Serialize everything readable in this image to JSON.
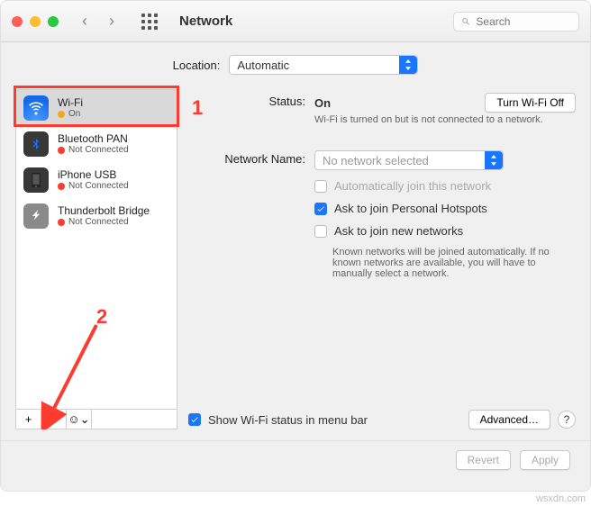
{
  "header": {
    "title": "Network",
    "search_placeholder": "Search"
  },
  "location": {
    "label": "Location:",
    "value": "Automatic"
  },
  "sidebar": {
    "items": [
      {
        "name": "Wi-Fi",
        "status": "On",
        "dot": "on",
        "icon": "wifi",
        "selected": true
      },
      {
        "name": "Bluetooth PAN",
        "status": "Not Connected",
        "dot": "off",
        "icon": "bt",
        "selected": false
      },
      {
        "name": "iPhone USB",
        "status": "Not Connected",
        "dot": "off",
        "icon": "usb",
        "selected": false
      },
      {
        "name": "Thunderbolt Bridge",
        "status": "Not Connected",
        "dot": "off",
        "icon": "tb",
        "selected": false
      }
    ],
    "actions": {
      "add": "+",
      "remove": "−",
      "more": "☺︎⌄"
    }
  },
  "detail": {
    "status_label": "Status:",
    "status_value": "On",
    "turn_off": "Turn Wi-Fi Off",
    "status_sub": "Wi-Fi is turned on but is not connected to a network.",
    "network_label": "Network Name:",
    "network_placeholder": "No network selected",
    "auto_join": "Automatically join this network",
    "ask_hotspot": "Ask to join Personal Hotspots",
    "ask_new": "Ask to join new networks",
    "ask_new_sub": "Known networks will be joined automatically. If no known networks are available, you will have to manually select a network.",
    "show_menubar": "Show Wi-Fi status in menu bar",
    "advanced": "Advanced…",
    "help": "?"
  },
  "footer": {
    "revert": "Revert",
    "apply": "Apply"
  },
  "annotations": {
    "one": "1",
    "two": "2"
  },
  "watermark": "wsxdn.com"
}
